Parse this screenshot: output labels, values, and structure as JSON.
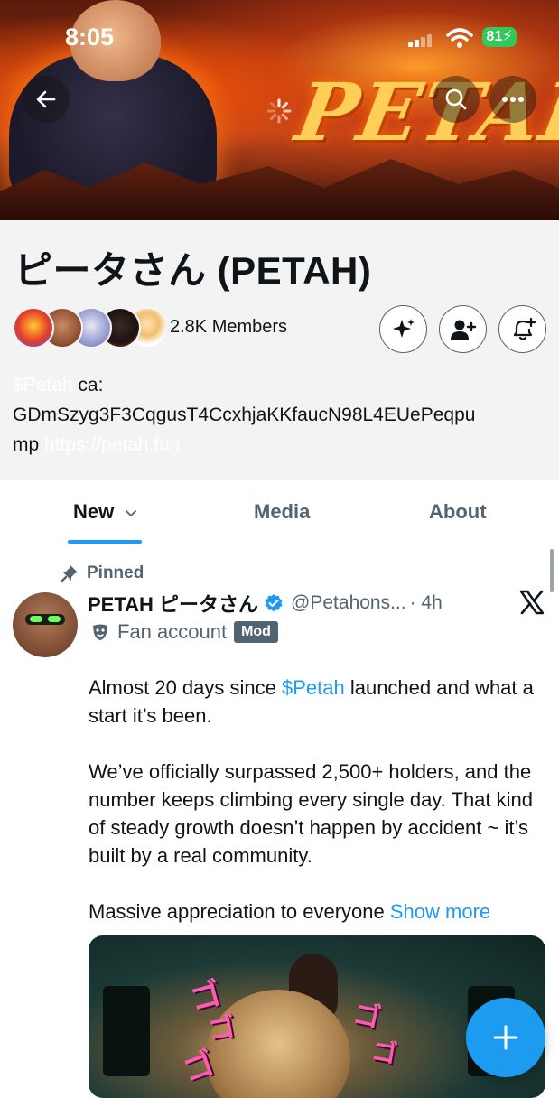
{
  "status_bar": {
    "time": "8:05",
    "battery": "81"
  },
  "banner": {
    "title_art": "PETAH"
  },
  "community": {
    "name": "ピータさん (PETAH)",
    "members": "2.8K Members",
    "description_line1_faint": "$Petah",
    "description_line1": " ca:",
    "description_line2": "GDmSzyg3F3CqgusT4CcxhjaKKfaucN98L4EUePeqpu",
    "description_line3": "mp",
    "description_line3_faint": " https://petah.fun"
  },
  "tabs": [
    {
      "label": "New"
    },
    {
      "label": "Media"
    },
    {
      "label": "About"
    }
  ],
  "post": {
    "pinned_label": "Pinned",
    "author_name": "PETAH ピータさん",
    "handle": "@Petahons...",
    "time": "· 4h",
    "account_type": "Fan account",
    "role_badge": "Mod",
    "para1_before": "Almost 20 days since ",
    "para1_link": "$Petah",
    "para1_after": " launched and what a start it’s been.",
    "para2": "We’ve officially surpassed 2,500+ holders, and the number keeps climbing every single day. That kind of steady growth doesn’t happen by accident ~ it’s built by a real community.",
    "para3": "Massive appreciation to everyone ",
    "show_more": "Show more",
    "media_art_text": "ゴ"
  },
  "colors": {
    "accent": "#1d9bf0",
    "verified": "#1d9bf0",
    "secondary_text": "#536471",
    "battery": "#34c759"
  },
  "icons": [
    "back-arrow-icon",
    "search-icon",
    "more-icon",
    "sparkle-icon",
    "add-member-icon",
    "notification-bell-icon",
    "pin-icon",
    "verified-icon",
    "x-logo-icon",
    "theater-mask-icon",
    "plus-icon"
  ]
}
